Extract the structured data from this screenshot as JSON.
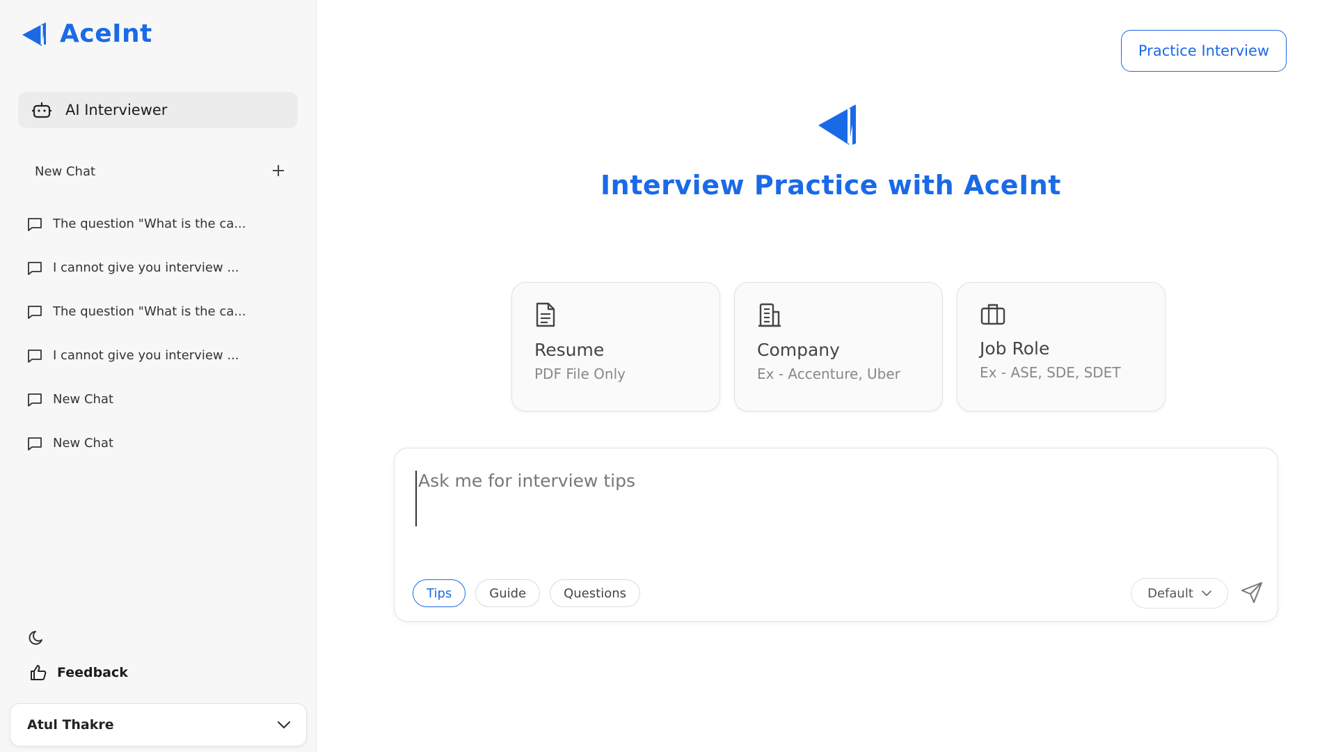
{
  "brand": {
    "name": "AceInt"
  },
  "sidebar": {
    "ai_interviewer_label": "AI Interviewer",
    "new_chat_label": "New Chat",
    "chats": [
      {
        "label": "The question \"What is the ca..."
      },
      {
        "label": "I cannot give you interview ..."
      },
      {
        "label": "The question \"What is the ca..."
      },
      {
        "label": "I cannot give you interview ..."
      },
      {
        "label": "New Chat"
      },
      {
        "label": "New Chat"
      }
    ],
    "feedback_label": "Feedback",
    "user_name": "Atul Thakre"
  },
  "header": {
    "practice_button": "Practice Interview"
  },
  "hero": {
    "title": "Interview Practice with AceInt"
  },
  "cards": [
    {
      "title": "Resume",
      "subtitle": "PDF File Only",
      "icon": "document-icon"
    },
    {
      "title": "Company",
      "subtitle": "Ex - Accenture, Uber",
      "icon": "building-icon"
    },
    {
      "title": "Job Role",
      "subtitle": "Ex - ASE, SDE, SDET",
      "icon": "briefcase-icon"
    }
  ],
  "chat": {
    "placeholder": "Ask me for interview tips",
    "chips": [
      {
        "label": "Tips",
        "active": true
      },
      {
        "label": "Guide",
        "active": false
      },
      {
        "label": "Questions",
        "active": false
      }
    ],
    "model_select": "Default"
  },
  "colors": {
    "accent": "#1a6ae8",
    "sidebar_bg": "#f7f7f7"
  }
}
